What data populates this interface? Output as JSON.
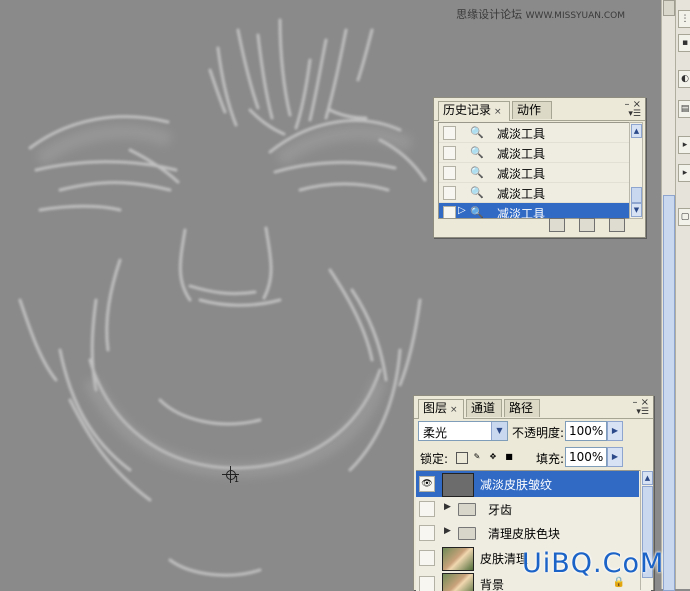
{
  "watermark_top": {
    "text": "思缘设计论坛",
    "url": "WWW.MISSYUAN.COM"
  },
  "watermark_bottom": "UiBQ.CoM",
  "cursor_label": "1",
  "history_panel": {
    "tabs": [
      {
        "label": "历史记录",
        "close": "×"
      },
      {
        "label": "动作"
      }
    ],
    "window_buttons": "– ×",
    "menu_arrow": "▾☰",
    "items": [
      {
        "label": "减淡工具",
        "selected": false
      },
      {
        "label": "减淡工具",
        "selected": false
      },
      {
        "label": "减淡工具",
        "selected": false
      },
      {
        "label": "减淡工具",
        "selected": false
      },
      {
        "label": "减淡工具",
        "selected": true
      }
    ],
    "current_marker": "▷",
    "footer_icons": [
      "new-document-from-state-icon",
      "new-snapshot-icon",
      "delete-icon"
    ]
  },
  "layers_panel": {
    "tabs": [
      {
        "label": "图层",
        "close": "×"
      },
      {
        "label": "通道"
      },
      {
        "label": "路径"
      }
    ],
    "window_buttons": "– ×",
    "menu_arrow": "▾☰",
    "blend_mode": "柔光",
    "opacity_label": "不透明度:",
    "opacity_value": "100%",
    "lock_label": "锁定:",
    "fill_label": "填充:",
    "fill_value": "100%",
    "layers": [
      {
        "name": "减淡皮肤皱纹",
        "selected": true,
        "visible": true,
        "kind": "layer"
      },
      {
        "name": "牙齿",
        "selected": false,
        "visible": false,
        "kind": "group"
      },
      {
        "name": "清理皮肤色块",
        "selected": false,
        "visible": false,
        "kind": "group"
      },
      {
        "name": "皮肤清理",
        "selected": false,
        "visible": false,
        "kind": "photo"
      },
      {
        "name": "背景",
        "selected": false,
        "visible": false,
        "kind": "photo"
      }
    ]
  },
  "colors": {
    "canvas": "#8a8a8a",
    "selection": "#316ac5",
    "panel": "#ece9d8",
    "watermark_blue": "#1b63c7"
  }
}
